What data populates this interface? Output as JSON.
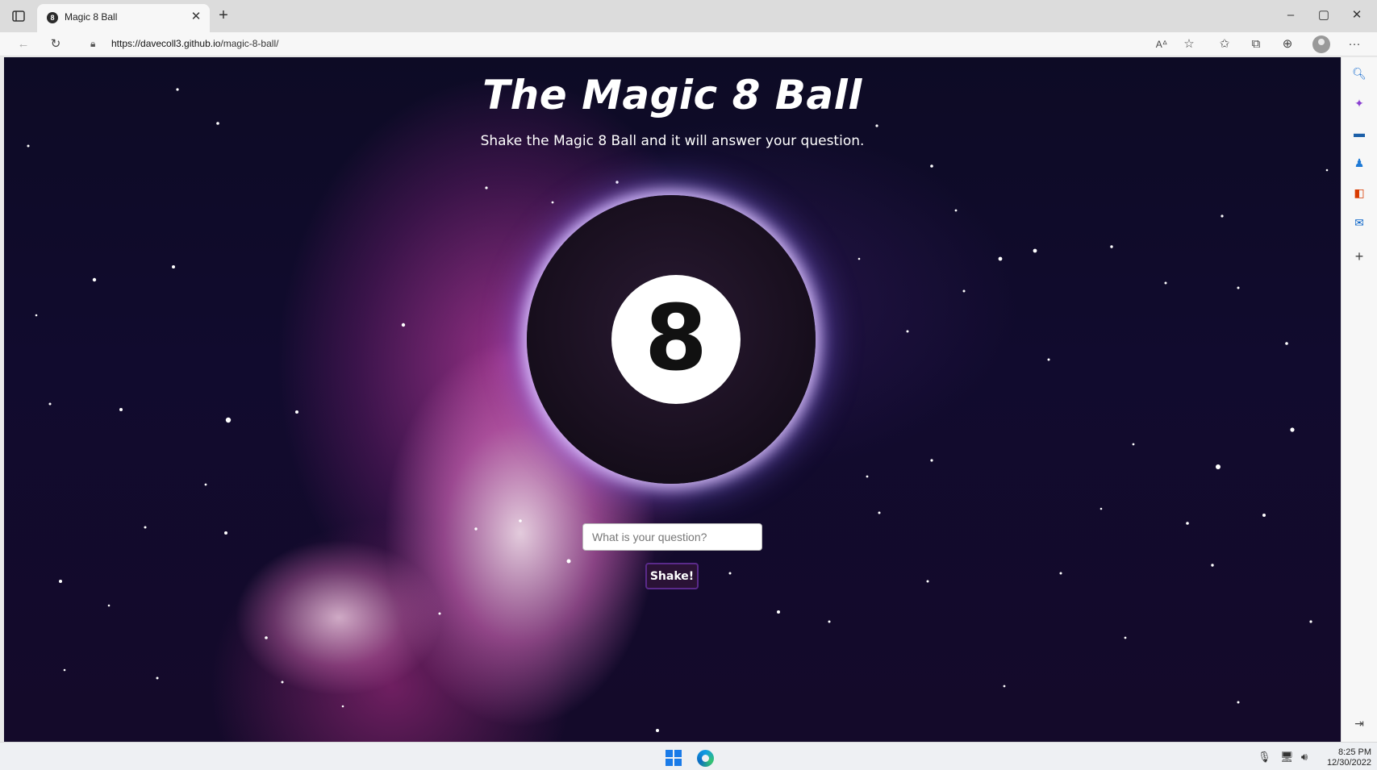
{
  "browser": {
    "tab_title": "Magic 8 Ball",
    "tab_favicon_text": "8",
    "url_host": "https://davecoll3.github.io",
    "url_path": "/magic-8-ball/"
  },
  "page": {
    "title": "The Magic 8 Ball",
    "subtitle": "Shake the Magic 8 Ball and it will answer your question.",
    "ball_number": "8",
    "question_placeholder": "What is your question?",
    "shake_label": "Shake!"
  },
  "taskbar": {
    "time": "8:25 PM",
    "date": "12/30/2022"
  },
  "colors": {
    "accent": "#5a2a8a",
    "sidebar_search": "#1a6fd1",
    "sidebar_office": "#d83b01",
    "sidebar_outlook": "#0a64c8"
  },
  "icons": [
    "tab-actions-icon",
    "close-icon",
    "plus-icon",
    "back-icon",
    "refresh-icon",
    "lock-icon",
    "read-aloud-icon",
    "add-favorite-icon",
    "favorites-icon",
    "collections-icon",
    "extensions-icon",
    "profile-icon",
    "more-icon",
    "search-icon",
    "copilot-icon",
    "tools-icon",
    "games-icon",
    "office-icon",
    "outlook-icon",
    "add-icon",
    "hide-sidebar-icon",
    "windows-start-icon",
    "edge-icon",
    "microphone-icon",
    "network-icon",
    "volume-icon"
  ]
}
